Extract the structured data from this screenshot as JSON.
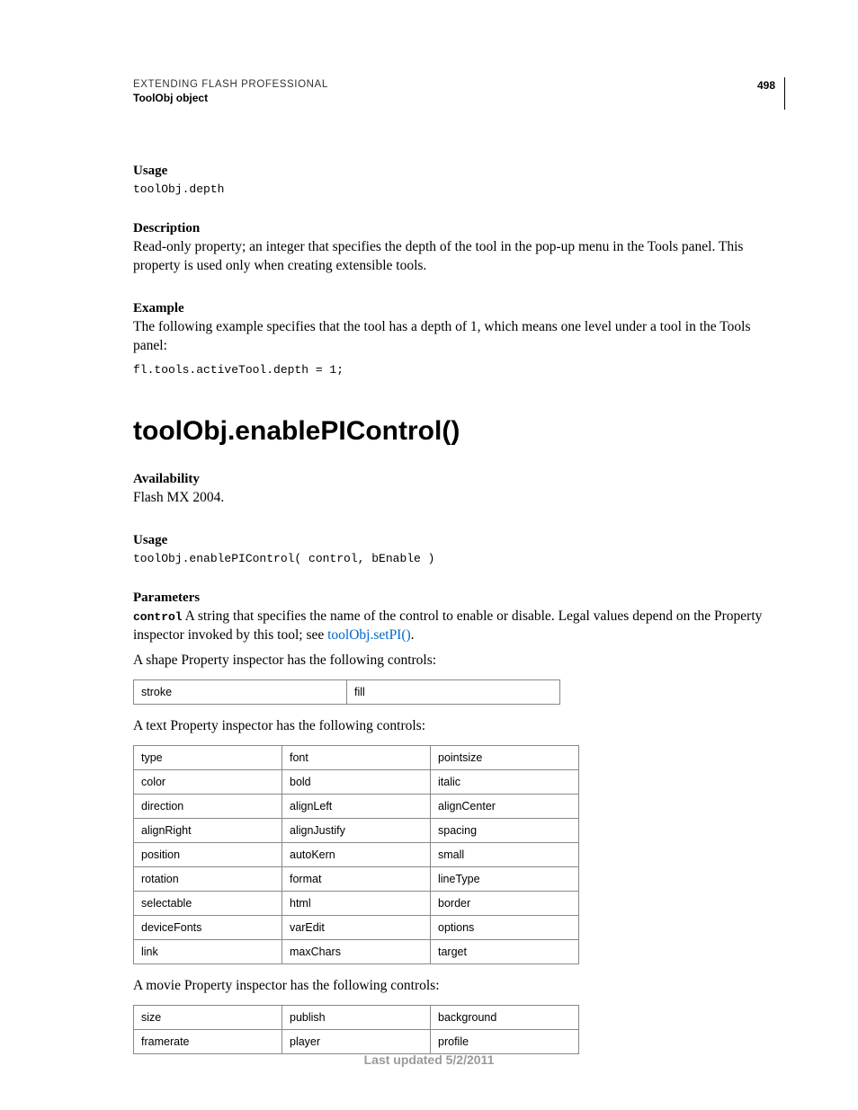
{
  "header": {
    "title": "EXTENDING FLASH PROFESSIONAL",
    "subtitle": "ToolObj object",
    "page_number": "498"
  },
  "depth_section": {
    "usage_label": "Usage",
    "usage_code": "toolObj.depth",
    "description_label": "Description",
    "description_text": "Read-only property; an integer that specifies the depth of the tool in the pop-up menu in the Tools panel. This property is used only when creating extensible tools.",
    "example_label": "Example",
    "example_text": "The following example specifies that the tool has a depth of 1, which means one level under a tool in the Tools panel:",
    "example_code": "fl.tools.activeTool.depth = 1;"
  },
  "method": {
    "title": "toolObj.enablePIControl()",
    "availability_label": "Availability",
    "availability_text": "Flash MX 2004.",
    "usage_label": "Usage",
    "usage_code": "toolObj.enablePIControl( control, bEnable )",
    "parameters_label": "Parameters",
    "param_control_name": "control",
    "param_control_text_1": " A string that specifies the name of the control to enable or disable. Legal values depend on the Property inspector invoked by this tool; see ",
    "param_control_link": "toolObj.setPI()",
    "param_control_text_2": ".",
    "shape_intro": "A shape Property inspector has the following controls:",
    "shape_table": [
      [
        "stroke",
        "fill"
      ]
    ],
    "text_intro": "A text Property inspector has the following controls:",
    "text_table": [
      [
        "type",
        "font",
        "pointsize"
      ],
      [
        "color",
        "bold",
        "italic"
      ],
      [
        "direction",
        "alignLeft",
        "alignCenter"
      ],
      [
        "alignRight",
        "alignJustify",
        "spacing"
      ],
      [
        "position",
        "autoKern",
        "small"
      ],
      [
        "rotation",
        "format",
        "lineType"
      ],
      [
        "selectable",
        "html",
        "border"
      ],
      [
        "deviceFonts",
        "varEdit",
        "options"
      ],
      [
        "link",
        "maxChars",
        "target"
      ]
    ],
    "movie_intro": "A movie Property inspector has the following controls:",
    "movie_table": [
      [
        "size",
        "publish",
        "background"
      ],
      [
        "framerate",
        "player",
        "profile"
      ]
    ]
  },
  "footer": "Last updated 5/2/2011"
}
